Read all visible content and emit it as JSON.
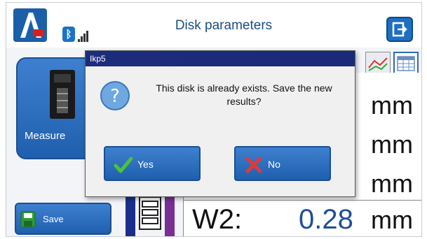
{
  "header": {
    "title": "Disk parameters"
  },
  "left_panel": {
    "measure_label": "Measure",
    "save_label": "Save"
  },
  "data_panel": {
    "units": [
      "mm",
      "mm",
      "mm",
      "mm"
    ],
    "w2_label": "W2:",
    "w2_value": "0.28"
  },
  "dialog": {
    "title": "Ikp5",
    "message": "This disk is already exists. Save the new results?",
    "yes_label": "Yes",
    "no_label": "No"
  },
  "colors": {
    "accent": "#1f5fae",
    "titlebar": "#1c2c7c",
    "value": "#1d4f95"
  },
  "icons": [
    "logo-icon",
    "bluetooth-icon",
    "signal-icon",
    "exit-icon",
    "measure-device-icon",
    "save-icon",
    "question-icon",
    "check-icon",
    "cross-icon",
    "chart-icon",
    "table-icon",
    "disk-icon"
  ]
}
